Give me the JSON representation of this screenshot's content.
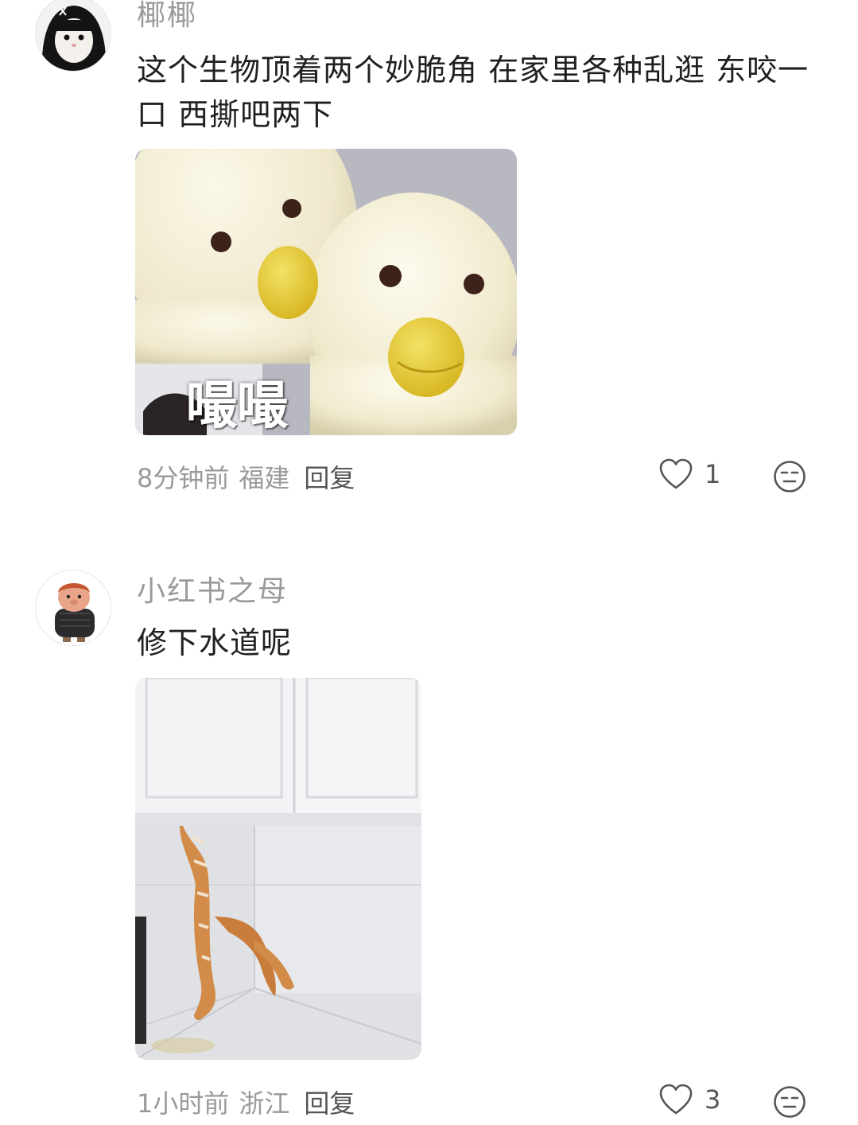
{
  "comments": [
    {
      "username": "椰椰",
      "text": "这个生物顶着两个妙脆角 在家里各种乱逛 东咬一口 西撕吧两下",
      "image_caption": "嘬嘬",
      "time": "8分钟前",
      "location": "福建",
      "reply_label": "回复",
      "likes": "1"
    },
    {
      "username": "小红书之母",
      "text": "修下水道呢",
      "time": "1小时前",
      "location": "浙江",
      "reply_label": "回复",
      "likes": "3"
    }
  ],
  "icons": {
    "like": "heart-outline-icon",
    "dislike": "meh-face-icon"
  },
  "colors": {
    "muted_text": "#9a9a9a",
    "body_text": "#202020"
  }
}
